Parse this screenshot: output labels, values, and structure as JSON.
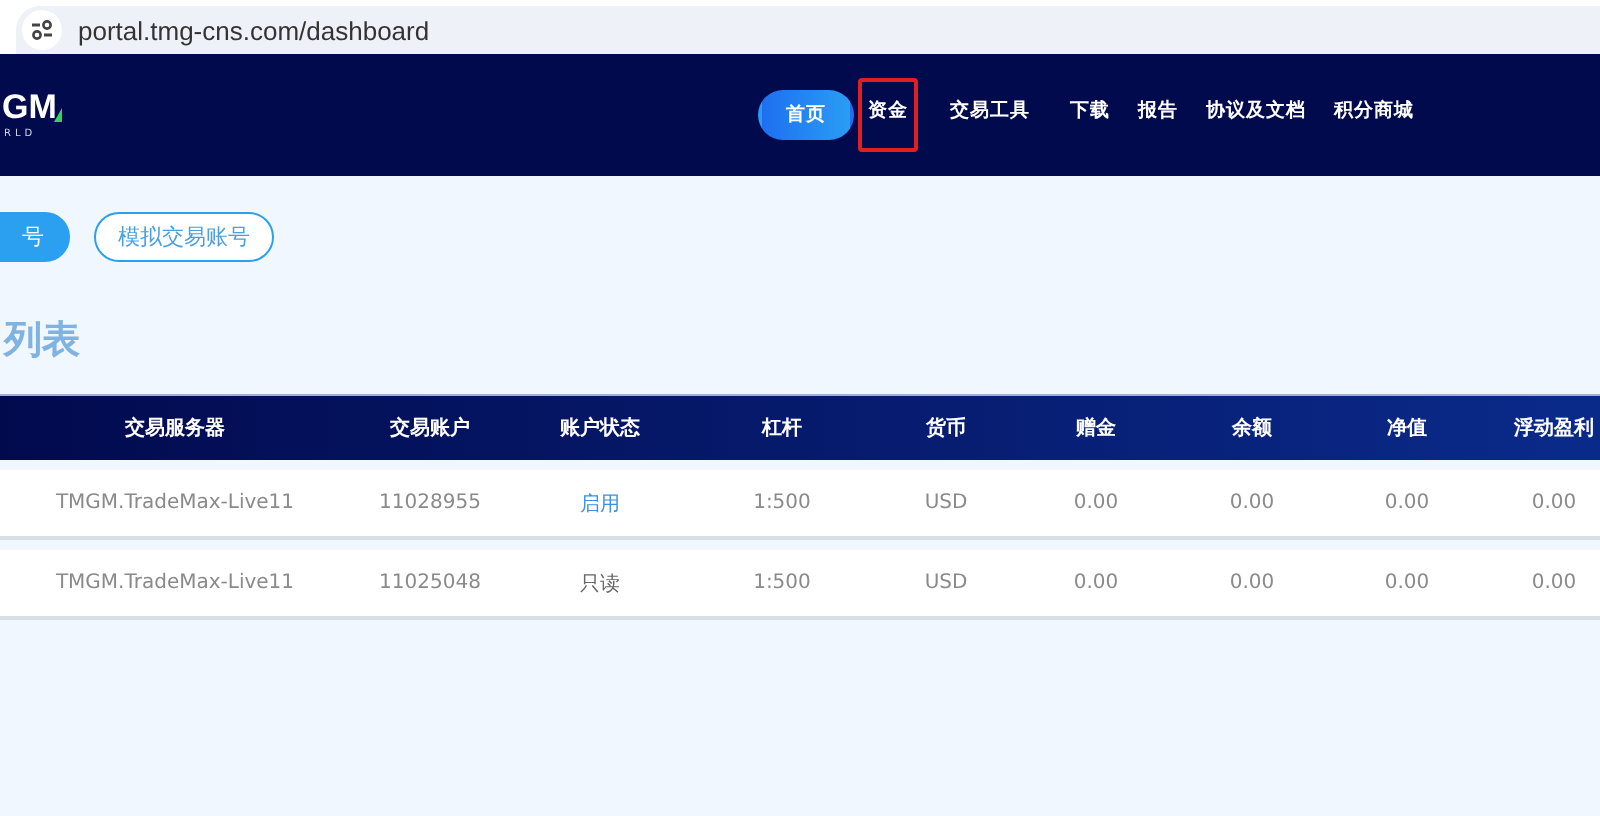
{
  "address_bar": {
    "url": "portal.tmg-cns.com/dashboard"
  },
  "header": {
    "logo": {
      "mark": "GM",
      "tagline": "RLD"
    },
    "nav": [
      {
        "label": "首页",
        "selected": true,
        "highlighted": false
      },
      {
        "label": "资金",
        "selected": false,
        "highlighted": true
      },
      {
        "label": "交易工具",
        "selected": false,
        "highlighted": false
      },
      {
        "label": "下载",
        "selected": false,
        "highlighted": false
      },
      {
        "label": "报告",
        "selected": false,
        "highlighted": false
      },
      {
        "label": "协议及文档",
        "selected": false,
        "highlighted": false
      },
      {
        "label": "积分商城",
        "selected": false,
        "highlighted": false
      }
    ]
  },
  "account_tabs": [
    {
      "label": "号",
      "selected": true
    },
    {
      "label": "模拟交易账号",
      "selected": false
    }
  ],
  "section_title": "列表",
  "table": {
    "columns": [
      "交易服务器",
      "交易账户",
      "账户状态",
      "杠杆",
      "货币",
      "赠金",
      "余额",
      "净值",
      "浮动盈利"
    ],
    "rows": [
      {
        "cells": [
          "TMGM.TradeMax-Live11",
          "11028955",
          "启用",
          "1:500",
          "USD",
          "0.00",
          "0.00",
          "0.00",
          "0.00"
        ],
        "kind": "enabled"
      },
      {
        "cells": [
          "TMGM.TradeMax-Live11",
          "11025048",
          "只读",
          "1:500",
          "USD",
          "0.00",
          "0.00",
          "0.00",
          "0.00"
        ],
        "kind": "readonly"
      }
    ]
  }
}
